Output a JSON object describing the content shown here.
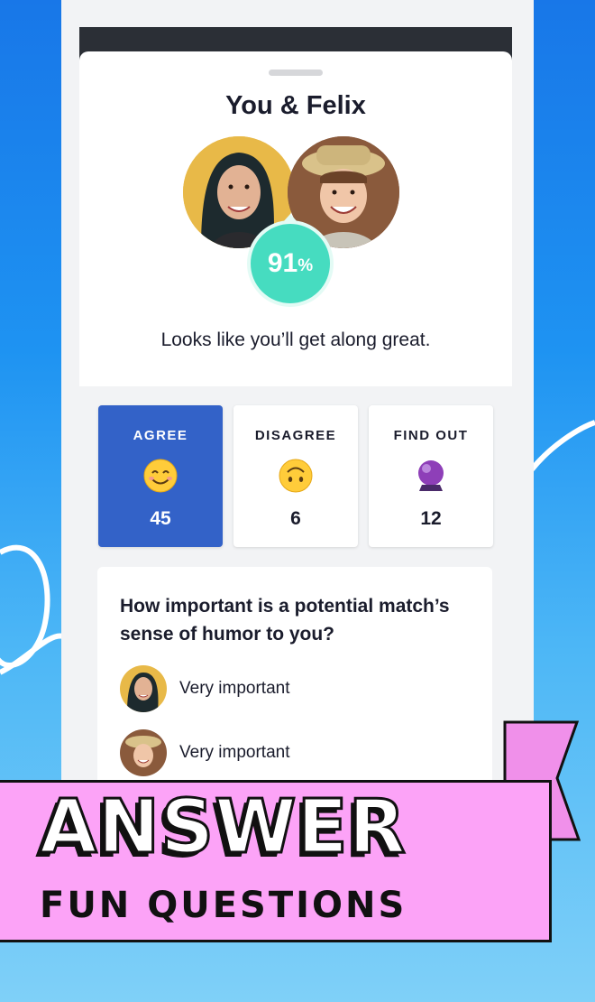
{
  "match": {
    "title": "You & Felix",
    "percent": "91",
    "percent_symbol": "%",
    "verdict": "Looks like you’ll get along great."
  },
  "stats": [
    {
      "label": "AGREE",
      "emoji": "smiling-face-icon",
      "count": "45"
    },
    {
      "label": "DISAGREE",
      "emoji": "upside-down-face-icon",
      "count": "6"
    },
    {
      "label": "FIND OUT",
      "emoji": "crystal-ball-icon",
      "count": "12"
    }
  ],
  "question": {
    "text": "How important is a potential match’s sense of humor to you?",
    "answers": [
      {
        "who": "user",
        "text": "Very important"
      },
      {
        "who": "felix",
        "text": "Very important"
      }
    ]
  },
  "promo": {
    "headline": "ANSWER",
    "subline": "FUN QUESTIONS"
  },
  "colors": {
    "active_tab": "#3362c8",
    "match_badge": "#46dcc0",
    "banner": "#fca3f7"
  }
}
